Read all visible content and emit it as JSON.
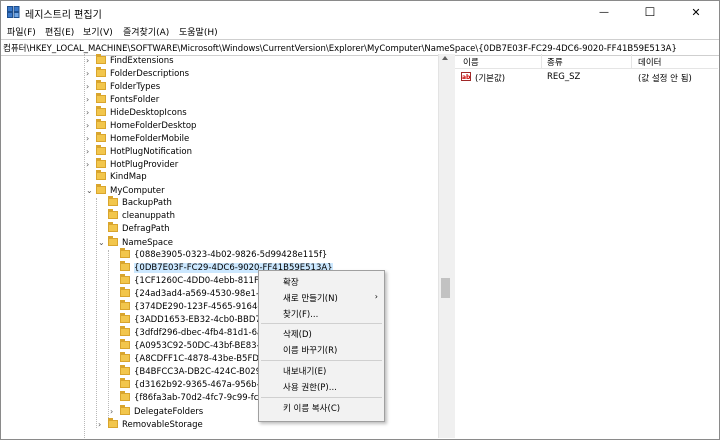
{
  "window": {
    "title": "레지스트리 편집기",
    "minimize_glyph": "—",
    "maximize_glyph": "☐",
    "close_glyph": "✕"
  },
  "menu": [
    "파일(F)",
    "편집(E)",
    "보기(V)",
    "즐겨찾기(A)",
    "도움말(H)"
  ],
  "address": "컴퓨터\\HKEY_LOCAL_MACHINE\\SOFTWARE\\Microsoft\\Windows\\CurrentVersion\\Explorer\\MyComputer\\NameSpace\\{0DB7E03F-FC29-4DC6-9020-FF41B59E513A}",
  "tree": {
    "level1": [
      {
        "label": "FindExtensions",
        "expander": "›"
      },
      {
        "label": "FolderDescriptions",
        "expander": "›"
      },
      {
        "label": "FolderTypes",
        "expander": "›"
      },
      {
        "label": "FontsFolder",
        "expander": "›"
      },
      {
        "label": "HideDesktopIcons",
        "expander": "›"
      },
      {
        "label": "HomeFolderDesktop",
        "expander": "›"
      },
      {
        "label": "HomeFolderMobile",
        "expander": "›"
      },
      {
        "label": "HotPlugNotification",
        "expander": "›"
      },
      {
        "label": "HotPlugProvider",
        "expander": "›"
      },
      {
        "label": "KindMap",
        "expander": ""
      },
      {
        "label": "MyComputer",
        "expander": "⌄"
      }
    ],
    "mycomputer_children": [
      {
        "label": "BackupPath",
        "expander": ""
      },
      {
        "label": "cleanuppath",
        "expander": ""
      },
      {
        "label": "DefragPath",
        "expander": ""
      },
      {
        "label": "NameSpace",
        "expander": "⌄"
      }
    ],
    "namespace_children": [
      {
        "label": "{088e3905-0323-4b02-9826-5d99428e115f}",
        "expander": ""
      },
      {
        "label": "{0DB7E03F-FC29-4DC6-9020-FF41B59E513A}",
        "expander": "",
        "selected": true
      },
      {
        "label": "{1CF1260C-4DD0-4ebb-811F-",
        "expander": ""
      },
      {
        "label": "{24ad3ad4-a569-4530-98e1-a",
        "expander": ""
      },
      {
        "label": "{374DE290-123F-4565-9164-",
        "expander": ""
      },
      {
        "label": "{3ADD1653-EB32-4cb0-BBD7",
        "expander": ""
      },
      {
        "label": "{3dfdf296-dbec-4fb4-81d1-6a",
        "expander": ""
      },
      {
        "label": "{A0953C92-50DC-43bf-BE83-",
        "expander": ""
      },
      {
        "label": "{A8CDFF1C-4878-43be-B5FD-",
        "expander": ""
      },
      {
        "label": "{B4BFCC3A-DB2C-424C-B029",
        "expander": ""
      },
      {
        "label": "{d3162b92-9365-467a-956b-",
        "expander": ""
      },
      {
        "label": "{f86fa3ab-70d2-4fc7-9c99-fcb",
        "expander": ""
      },
      {
        "label": "DelegateFolders",
        "expander": "›"
      }
    ],
    "after": [
      {
        "label": "RemovableStorage",
        "expander": "›"
      }
    ]
  },
  "values_pane": {
    "columns": [
      "이름",
      "종류",
      "데이터"
    ],
    "rows": [
      {
        "icon": "ab",
        "name": "(기본값)",
        "type": "REG_SZ",
        "data": "(값 설정 안 됨)"
      }
    ]
  },
  "context_menu": {
    "items": [
      {
        "label": "확장"
      },
      {
        "label": "새로 만들기(N)",
        "submenu_arrow": "›"
      },
      {
        "label": "찾기(F)..."
      },
      {
        "label": "삭제(D)"
      },
      {
        "label": "이름 바꾸기(R)"
      },
      {
        "label": "내보내기(E)"
      },
      {
        "label": "사용 권한(P)..."
      },
      {
        "label": "키 이름 복사(C)"
      }
    ]
  }
}
